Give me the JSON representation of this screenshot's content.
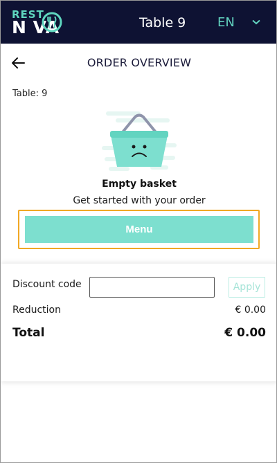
{
  "header": {
    "logo_top": "REST",
    "logo_bottom": "N  VA",
    "table_title": "Table 9",
    "language": "EN",
    "background_color": "#0e1233",
    "accent_color": "#5fd6bf"
  },
  "page": {
    "title": "ORDER OVERVIEW",
    "table_info": "Table: 9"
  },
  "empty_state": {
    "title": "Empty basket",
    "subtitle": "Get started with your order",
    "illustration": "basket-sad-icon",
    "menu_button_label": "Menu"
  },
  "summary": {
    "discount_label": "Discount code",
    "discount_value": "",
    "apply_label": "Apply",
    "reduction_label": "Reduction",
    "reduction_value": "€ 0.00",
    "total_label": "Total",
    "total_value": "€ 0.00"
  },
  "icons": {
    "back": "arrow-left-icon",
    "language_dropdown": "chevron-down-icon"
  }
}
